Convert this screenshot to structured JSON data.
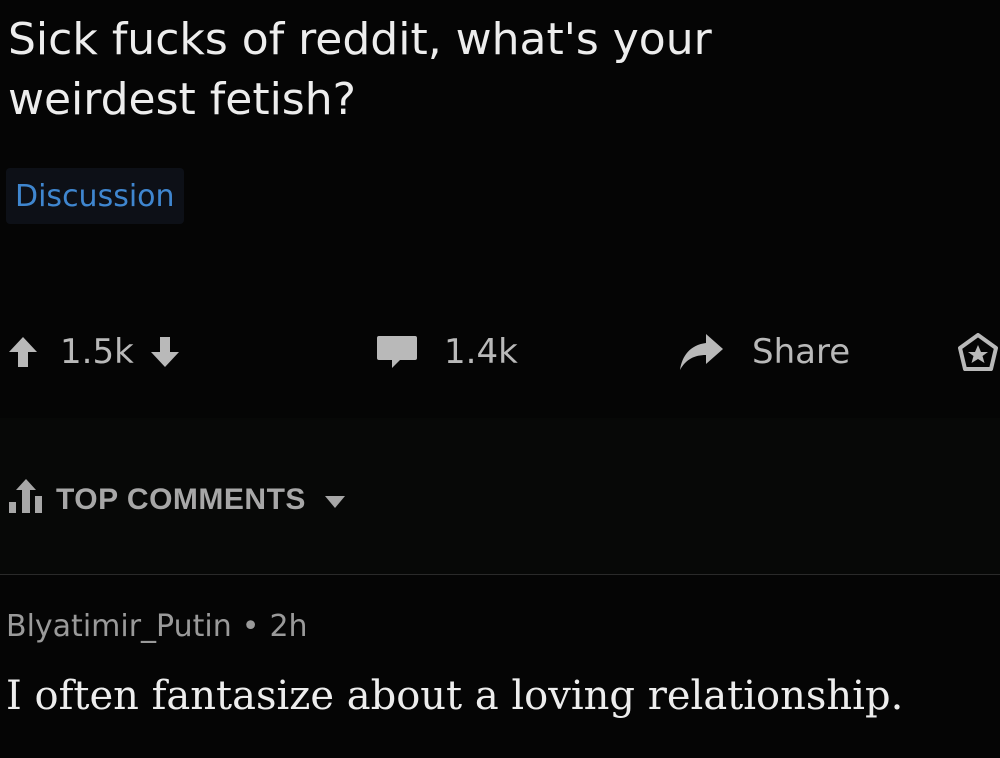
{
  "post": {
    "title": "Sick fucks of reddit, what's your weirdest fetish?",
    "flair": "Discussion",
    "flair_color": "#3f86cf",
    "actions": {
      "upvote_icon": "arrow-up-icon",
      "vote_count": "1.5k",
      "downvote_icon": "arrow-down-icon",
      "comment_icon": "comment-bubble-icon",
      "comment_count": "1.4k",
      "share_icon": "share-arrow-icon",
      "share_label": "Share",
      "save_icon": "award-icon"
    }
  },
  "comments_sort": {
    "icon": "top-sort-icon",
    "label": "TOP COMMENTS",
    "dropdown_icon": "caret-down-icon"
  },
  "comment": {
    "author": "Blyatimir_Putin",
    "separator": "•",
    "age": "2h",
    "text": "I often fantasize about a loving relationship."
  }
}
